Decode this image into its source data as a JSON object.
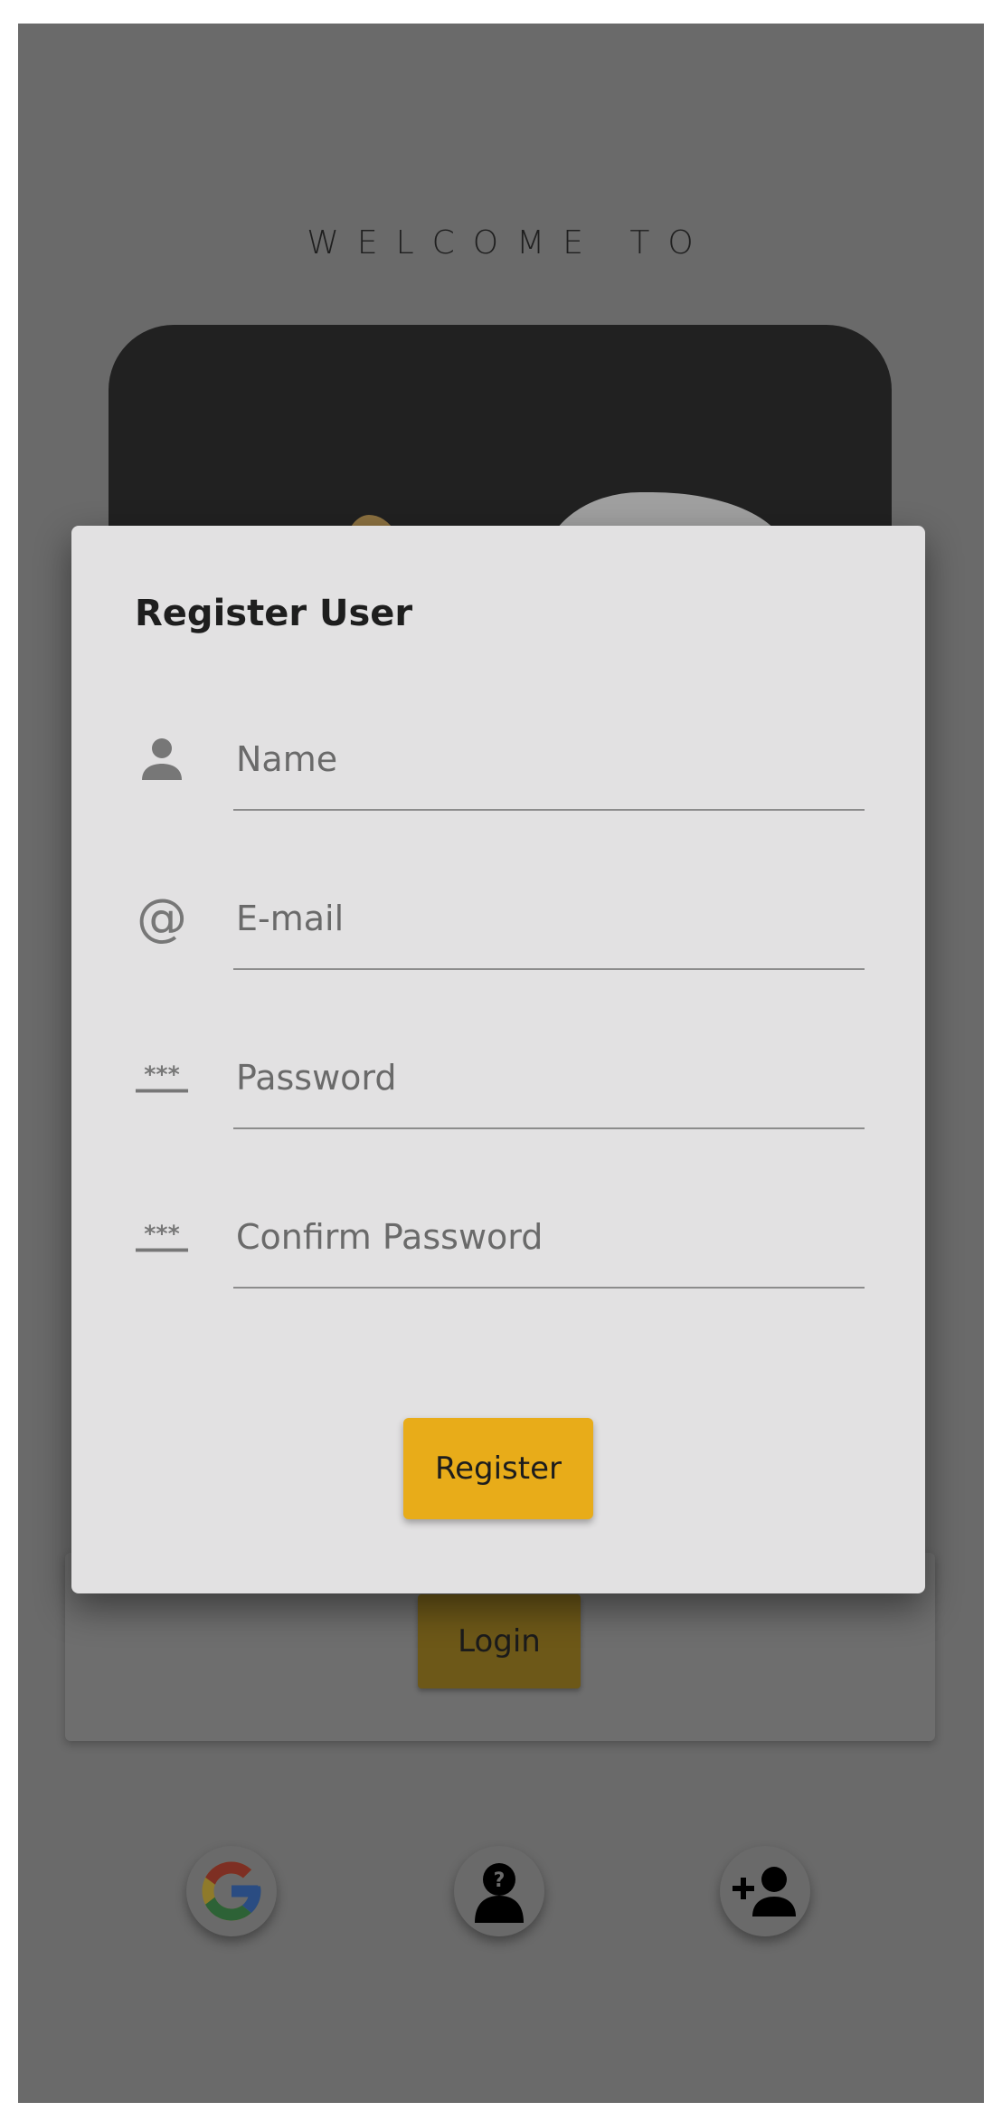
{
  "background": {
    "welcome_text": "WELCOME TO",
    "login_label": "Login"
  },
  "dialog": {
    "title": "Register User",
    "fields": [
      {
        "placeholder": "Name",
        "value": "",
        "icon": "person-icon"
      },
      {
        "placeholder": "E-mail",
        "value": "",
        "icon": "at-icon"
      },
      {
        "placeholder": "Password",
        "value": "",
        "icon": "password-icon"
      },
      {
        "placeholder": "Confirm Password",
        "value": "",
        "icon": "password-icon"
      }
    ],
    "register_label": "Register"
  },
  "social": {
    "items": [
      "google-icon",
      "anonymous-user-icon",
      "add-user-icon"
    ]
  },
  "colors": {
    "scrim": "#6a6a6a",
    "dialog_bg": "#e2e1e2",
    "accent": "#e8ac19"
  }
}
